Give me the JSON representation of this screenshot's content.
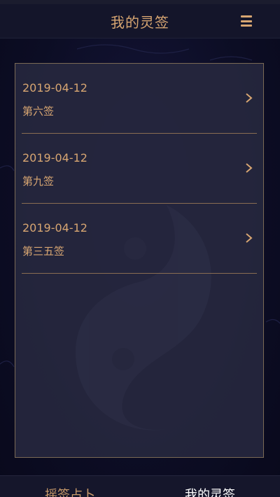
{
  "header": {
    "title": "我的灵签",
    "menu_icon": "hamburger-menu-icon"
  },
  "records": [
    {
      "date": "2019-04-12",
      "name": "第六签"
    },
    {
      "date": "2019-04-12",
      "name": "第九签"
    },
    {
      "date": "2019-04-12",
      "name": "第三五签"
    }
  ],
  "tabs": [
    {
      "label": "摇签占卜",
      "active": false
    },
    {
      "label": "我的灵签",
      "active": true
    }
  ],
  "colors": {
    "accent": "#d8a672",
    "background": "#0c0d24",
    "panel": "#26273e",
    "divider": "#8a6e52",
    "active_tab": "#ffffff"
  }
}
